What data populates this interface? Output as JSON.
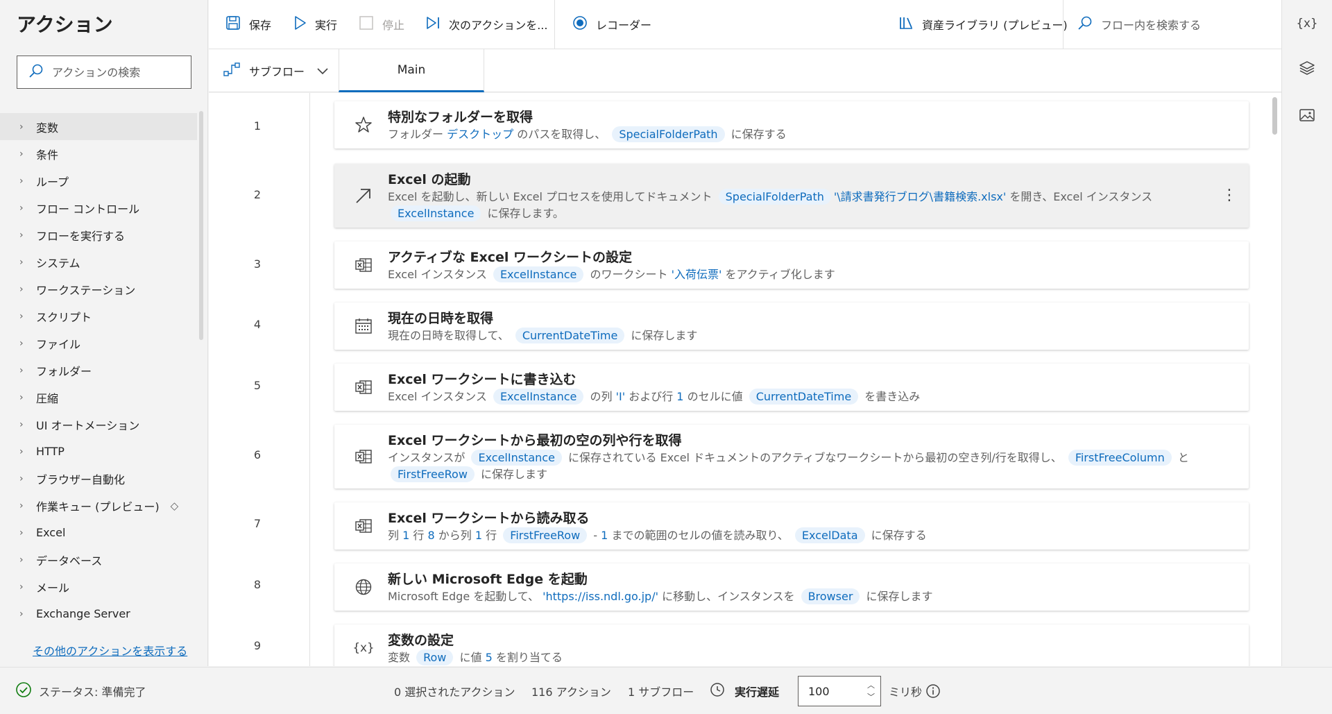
{
  "left_panel": {
    "title": "アクション",
    "search_placeholder": "アクションの検索",
    "categories": [
      {
        "label": "変数"
      },
      {
        "label": "条件"
      },
      {
        "label": "ループ"
      },
      {
        "label": "フロー コントロール"
      },
      {
        "label": "フローを実行する"
      },
      {
        "label": "システム"
      },
      {
        "label": "ワークステーション"
      },
      {
        "label": "スクリプト"
      },
      {
        "label": "ファイル"
      },
      {
        "label": "フォルダー"
      },
      {
        "label": "圧縮"
      },
      {
        "label": "UI オートメーション"
      },
      {
        "label": "HTTP"
      },
      {
        "label": "ブラウザー自動化"
      },
      {
        "label": "作業キュー (プレビュー)"
      },
      {
        "label": "Excel"
      },
      {
        "label": "データベース"
      },
      {
        "label": "メール"
      },
      {
        "label": "Exchange Server"
      }
    ],
    "more_link": "その他のアクションを表示する"
  },
  "toolbar": {
    "save": "保存",
    "run": "実行",
    "stop": "停止",
    "next_action": "次のアクションを...",
    "recorder": "レコーダー",
    "asset_library": "資産ライブラリ (プレビュー)",
    "search_placeholder": "フロー内を検索する"
  },
  "rail": {
    "variables_label": "{x}"
  },
  "tabs": {
    "subflow": "サブフロー",
    "main": "Main"
  },
  "steps": [
    {
      "n": "1",
      "title": "特別なフォルダーを取得",
      "icon": "star-icon"
    },
    {
      "n": "2",
      "title": "Excel の起動",
      "icon": "arrow-up-right-icon"
    },
    {
      "n": "3",
      "title": "アクティブな Excel ワークシートの設定",
      "icon": "excel-icon"
    },
    {
      "n": "4",
      "title": "現在の日時を取得",
      "icon": "calendar-icon"
    },
    {
      "n": "5",
      "title": "Excel ワークシートに書き込む",
      "icon": "excel-icon"
    },
    {
      "n": "6",
      "title": "Excel ワークシートから最初の空の列や行を取得",
      "icon": "excel-icon"
    },
    {
      "n": "7",
      "title": "Excel ワークシートから読み取る",
      "icon": "excel-icon"
    },
    {
      "n": "8",
      "title": "新しい Microsoft Edge を起動",
      "icon": "globe-icon"
    },
    {
      "n": "9",
      "title": "変数の設定",
      "icon": "variable-icon"
    }
  ],
  "step_text": {
    "s1": {
      "a": "フォルダー",
      "b": "デスクトップ",
      "c": "のパスを取得し、",
      "v1": "SpecialFolderPath",
      "d": "に保存する"
    },
    "s2": {
      "a": "Excel を起動し、新しい Excel プロセスを使用してドキュメント",
      "v1": "SpecialFolderPath",
      "lit": "'\\請求書発行ブログ\\書籍検索.xlsx'",
      "b": "を開き、Excel インスタンス",
      "v2": "ExcelInstance",
      "c": "に保存します。"
    },
    "s3": {
      "a": "Excel インスタンス",
      "v1": "ExcelInstance",
      "b": "のワークシート",
      "lit": "'入荷伝票'",
      "c": "をアクティブ化します"
    },
    "s4": {
      "a": "現在の日時を取得して、",
      "v1": "CurrentDateTime",
      "b": "に保存します"
    },
    "s5": {
      "a": "Excel インスタンス",
      "v1": "ExcelInstance",
      "b": "の列",
      "lit1": "'I'",
      "c": "および行",
      "lit2": "1",
      "d": "のセルに値",
      "v2": "CurrentDateTime",
      "e": "を書き込み"
    },
    "s6": {
      "a": "インスタンスが",
      "v1": "ExcelInstance",
      "b": "に保存されている Excel ドキュメントのアクティブなワークシートから最初の空き列/行を取得し、",
      "v2": "FirstFreeColumn",
      "c": "と",
      "v3": "FirstFreeRow",
      "d": "に保存します"
    },
    "s7": {
      "a": "列",
      "n1": "1",
      "b": "行",
      "n2": "8",
      "c": "から列",
      "n3": "1",
      "d": "行",
      "v1": "FirstFreeRow",
      "e": "-",
      "n4": "1",
      "f": "までの範囲のセルの値を読み取り、",
      "v2": "ExcelData",
      "g": "に保存する"
    },
    "s8": {
      "a": "Microsoft Edge を起動して、",
      "lit": "'https://iss.ndl.go.jp/'",
      "b": "に移動し、インスタンスを",
      "v1": "Browser",
      "c": "に保存します"
    },
    "s9": {
      "a": "変数",
      "v1": "Row",
      "b": "に値",
      "n1": "5",
      "c": "を割り当てる"
    }
  },
  "status": {
    "state": "ステータス: 準備完了",
    "selected": "0 選択されたアクション",
    "actions": "116 アクション",
    "subflows": "1 サブフロー",
    "delay_label": "実行遅延",
    "delay_value": "100",
    "unit": "ミリ秒"
  },
  "colors": {
    "accent": "#0f6cbd",
    "token_bg": "#e8f2fc",
    "status_ok": "#107c10"
  }
}
